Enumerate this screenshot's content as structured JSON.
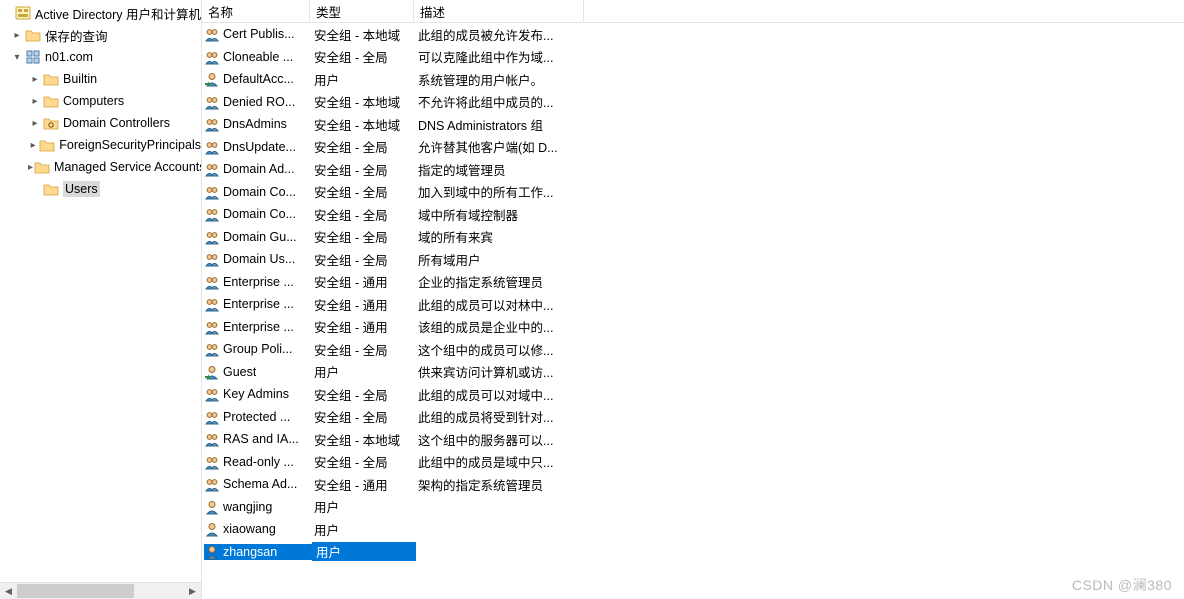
{
  "tree": [
    {
      "label": "Active Directory 用户和计算机",
      "indent": 0,
      "icon": "ad-root",
      "exp": "none",
      "selected": false
    },
    {
      "label": "保存的查询",
      "indent": 1,
      "icon": "folder",
      "exp": "closed",
      "selected": false
    },
    {
      "label": "n01.com",
      "indent": 1,
      "icon": "domain",
      "exp": "open",
      "selected": false
    },
    {
      "label": "Builtin",
      "indent": 2,
      "icon": "folder",
      "exp": "closed",
      "selected": false
    },
    {
      "label": "Computers",
      "indent": 2,
      "icon": "folder",
      "exp": "closed",
      "selected": false
    },
    {
      "label": "Domain Controllers",
      "indent": 2,
      "icon": "ou",
      "exp": "closed",
      "selected": false
    },
    {
      "label": "ForeignSecurityPrincipals",
      "indent": 2,
      "icon": "folder",
      "exp": "closed",
      "selected": false
    },
    {
      "label": "Managed Service Accounts",
      "indent": 2,
      "icon": "folder",
      "exp": "closed",
      "selected": false
    },
    {
      "label": "Users",
      "indent": 2,
      "icon": "folder",
      "exp": "none",
      "selected": true
    }
  ],
  "columns": {
    "name": "名称",
    "type": "类型",
    "desc": "描述"
  },
  "rows": [
    {
      "icon": "group",
      "name": "Cert Publis...",
      "type": "安全组 - 本地域",
      "desc": "此组的成员被允许发布..."
    },
    {
      "icon": "group",
      "name": "Cloneable ...",
      "type": "安全组 - 全局",
      "desc": "可以克隆此组中作为域..."
    },
    {
      "icon": "user-arrow",
      "name": "DefaultAcc...",
      "type": "用户",
      "desc": "系统管理的用户帐户。"
    },
    {
      "icon": "group",
      "name": "Denied RO...",
      "type": "安全组 - 本地域",
      "desc": "不允许将此组中成员的..."
    },
    {
      "icon": "group",
      "name": "DnsAdmins",
      "type": "安全组 - 本地域",
      "desc": "DNS Administrators 组"
    },
    {
      "icon": "group",
      "name": "DnsUpdate...",
      "type": "安全组 - 全局",
      "desc": "允许替其他客户端(如 D..."
    },
    {
      "icon": "group",
      "name": "Domain Ad...",
      "type": "安全组 - 全局",
      "desc": "指定的域管理员"
    },
    {
      "icon": "group",
      "name": "Domain Co...",
      "type": "安全组 - 全局",
      "desc": "加入到域中的所有工作..."
    },
    {
      "icon": "group",
      "name": "Domain Co...",
      "type": "安全组 - 全局",
      "desc": "域中所有域控制器"
    },
    {
      "icon": "group",
      "name": "Domain Gu...",
      "type": "安全组 - 全局",
      "desc": "域的所有来宾"
    },
    {
      "icon": "group",
      "name": "Domain Us...",
      "type": "安全组 - 全局",
      "desc": "所有域用户"
    },
    {
      "icon": "group",
      "name": "Enterprise ...",
      "type": "安全组 - 通用",
      "desc": "企业的指定系统管理员"
    },
    {
      "icon": "group",
      "name": "Enterprise ...",
      "type": "安全组 - 通用",
      "desc": "此组的成员可以对林中..."
    },
    {
      "icon": "group",
      "name": "Enterprise ...",
      "type": "安全组 - 通用",
      "desc": "该组的成员是企业中的..."
    },
    {
      "icon": "group",
      "name": "Group Poli...",
      "type": "安全组 - 全局",
      "desc": "这个组中的成员可以修..."
    },
    {
      "icon": "user-arrow",
      "name": "Guest",
      "type": "用户",
      "desc": "供来宾访问计算机或访..."
    },
    {
      "icon": "group",
      "name": "Key Admins",
      "type": "安全组 - 全局",
      "desc": "此组的成员可以对域中..."
    },
    {
      "icon": "group",
      "name": "Protected ...",
      "type": "安全组 - 全局",
      "desc": "此组的成员将受到针对..."
    },
    {
      "icon": "group",
      "name": "RAS and IA...",
      "type": "安全组 - 本地域",
      "desc": "这个组中的服务器可以..."
    },
    {
      "icon": "group",
      "name": "Read-only ...",
      "type": "安全组 - 全局",
      "desc": "此组中的成员是域中只..."
    },
    {
      "icon": "group",
      "name": "Schema Ad...",
      "type": "安全组 - 通用",
      "desc": "架构的指定系统管理员"
    },
    {
      "icon": "user",
      "name": "wangjing",
      "type": "用户",
      "desc": ""
    },
    {
      "icon": "user",
      "name": "xiaowang",
      "type": "用户",
      "desc": ""
    },
    {
      "icon": "user",
      "name": "zhangsan",
      "type": "用户",
      "desc": "",
      "selected": true
    }
  ],
  "watermark": "CSDN @澜380"
}
